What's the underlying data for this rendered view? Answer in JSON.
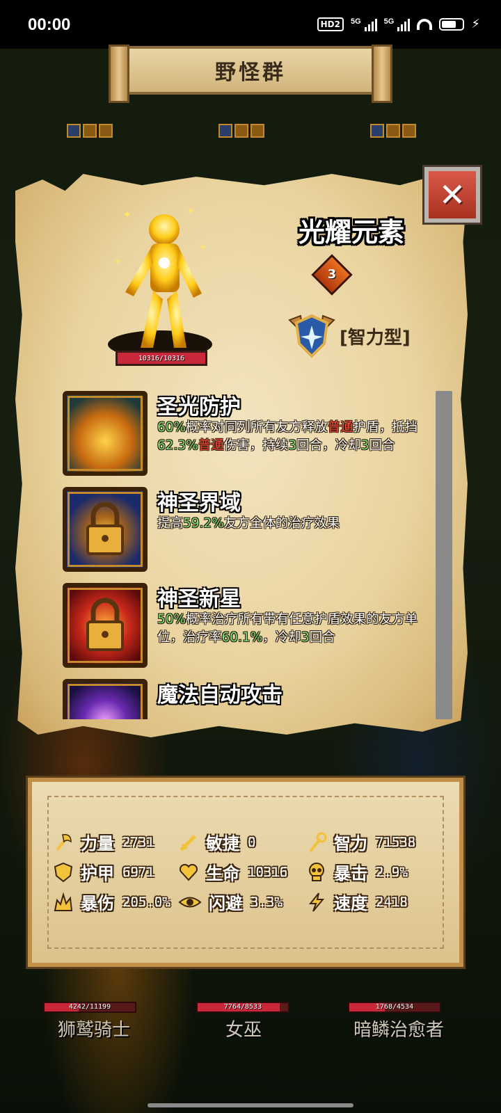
{
  "status_bar": {
    "time": "00:00",
    "hd": "HD2",
    "sig1": "5G",
    "sig2": "5G"
  },
  "banner": {
    "title": "野怪群"
  },
  "hero": {
    "name": "光耀元素",
    "hp_text": "10316/10316",
    "level": "3",
    "class_label": "[智力型]"
  },
  "skills": [
    {
      "name": "圣光防护",
      "desc_parts": [
        {
          "t": "60%",
          "c": "g"
        },
        {
          "t": "概率对同列所有友方释放"
        },
        {
          "t": "普通",
          "c": "r"
        },
        {
          "t": "护盾，抵挡"
        },
        {
          "t": "62.3%",
          "c": "g"
        },
        {
          "t": "普通",
          "c": "r"
        },
        {
          "t": "伤害，持续"
        },
        {
          "t": "3",
          "c": "g"
        },
        {
          "t": "回合，冷却"
        },
        {
          "t": "3",
          "c": "g"
        },
        {
          "t": "回合"
        }
      ]
    },
    {
      "name": "神圣界域",
      "desc_parts": [
        {
          "t": "提高"
        },
        {
          "t": "59.2%",
          "c": "g"
        },
        {
          "t": "友方全体的治疗效果"
        }
      ]
    },
    {
      "name": "神圣新星",
      "desc_parts": [
        {
          "t": "50%",
          "c": "g"
        },
        {
          "t": "概率治疗所有带有任意护盾效果的友方单位，治疗率"
        },
        {
          "t": "60.1%",
          "c": "g"
        },
        {
          "t": "，冷却"
        },
        {
          "t": "3",
          "c": "g"
        },
        {
          "t": "回合"
        }
      ]
    },
    {
      "name": "魔法自动攻击",
      "desc_parts": []
    }
  ],
  "stats": {
    "strength": {
      "label": "力量",
      "value": "2731"
    },
    "agility": {
      "label": "敏捷",
      "value": "0"
    },
    "intelligence": {
      "label": "智力",
      "value": "71538"
    },
    "armor": {
      "label": "护甲",
      "value": "6971"
    },
    "life": {
      "label": "生命",
      "value": "10316"
    },
    "crit": {
      "label": "暴击",
      "value": "2.9%"
    },
    "crit_damage": {
      "label": "暴伤",
      "value": "205.0%"
    },
    "dodge": {
      "label": "闪避",
      "value": "3.3%"
    },
    "speed": {
      "label": "速度",
      "value": "2418"
    }
  },
  "units": [
    {
      "name": "狮鹫骑士",
      "hp": "4242/11199",
      "fraction": 0.38
    },
    {
      "name": "女巫",
      "hp": "7764/8533",
      "fraction": 0.91
    },
    {
      "name": "暗鳞治愈者",
      "hp": "1768/4534",
      "fraction": 0.39
    }
  ],
  "colors": {
    "highlight_green": "#7ee07a",
    "highlight_red": "#ff4a3a",
    "close_red": "#c8463a",
    "hp_red": "#c8283a"
  }
}
